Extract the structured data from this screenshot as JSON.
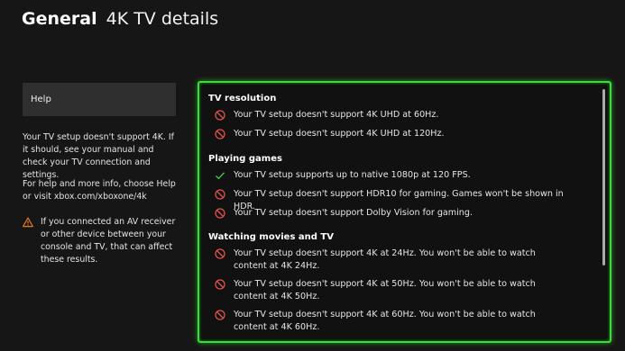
{
  "header": {
    "title": "General",
    "subtitle": "4K TV details"
  },
  "sidebar": {
    "help_label": "Help",
    "paragraph1": "Your TV setup doesn't support 4K. If it should, see your manual and check your TV connection and settings.",
    "paragraph2": "For help and more info, choose Help or visit xbox.com/xboxone/4k",
    "warning": "If you connected an AV receiver or other device between your console and TV, that can affect these results."
  },
  "details": {
    "tv_resolution": {
      "heading": "TV resolution",
      "items": [
        {
          "icon": "not-supported-icon",
          "text": "Your TV setup doesn't support 4K UHD at 60Hz."
        },
        {
          "icon": "not-supported-icon",
          "text": "Your TV setup doesn't support 4K UHD at 120Hz."
        }
      ]
    },
    "playing_games": {
      "heading": "Playing games",
      "items": [
        {
          "icon": "checkmark-icon",
          "text": "Your TV setup supports up to native 1080p at 120 FPS."
        },
        {
          "icon": "not-supported-icon",
          "text": "Your TV setup doesn't support HDR10 for gaming. Games won't be shown in HDR."
        },
        {
          "icon": "not-supported-icon",
          "text": "Your TV setup doesn't support Dolby Vision for gaming."
        }
      ]
    },
    "watching": {
      "heading": "Watching movies and TV",
      "items": [
        {
          "icon": "not-supported-icon",
          "text": "Your TV setup doesn't support 4K at 24Hz. You won't be able to watch content at 4K 24Hz."
        },
        {
          "icon": "not-supported-icon",
          "text": "Your TV setup doesn't support 4K at 50Hz. You won't be able to watch content at 4K 50Hz."
        },
        {
          "icon": "not-supported-icon",
          "text": "Your TV setup doesn't support 4K at 60Hz. You won't be able to watch content at 4K 60Hz."
        }
      ]
    }
  },
  "colors": {
    "accent": "#3ddc3d",
    "not_supported": "#e0524a",
    "supported": "#46c846",
    "warning": "#e87722"
  }
}
